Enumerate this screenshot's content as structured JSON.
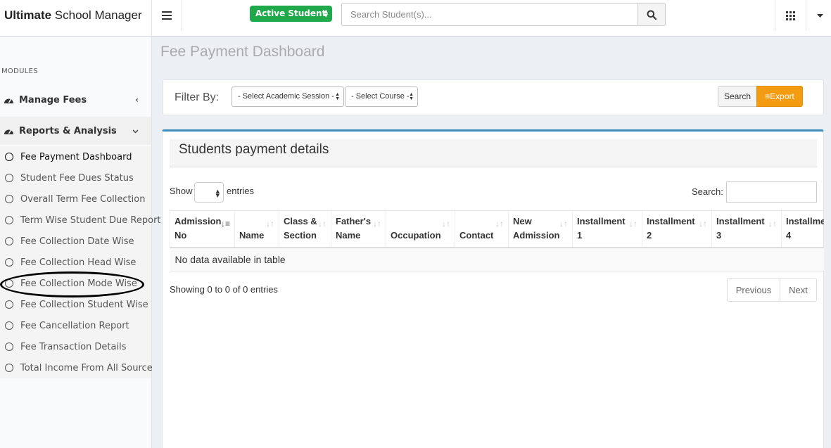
{
  "brand": {
    "bold": "Ultimate",
    "rest": " School Manager"
  },
  "topbar": {
    "active_student_label": "Active Student",
    "search_placeholder": "Search Student(s)..."
  },
  "sidebar": {
    "modules_label": "MODULES",
    "manage_fees": "Manage Fees",
    "reports_analysis": "Reports & Analysis",
    "items": [
      "Fee Payment Dashboard",
      "Student Fee Dues Status",
      "Overall Term Fee Collection",
      "Term Wise Student Due Report",
      "Fee Collection Date Wise",
      "Fee Collection Head Wise",
      "Fee Collection Mode Wise",
      "Fee Collection Student Wise",
      "Fee Cancellation Report",
      "Fee Transaction Details",
      "Total Income From All Source"
    ],
    "active_item": "Fee Payment Dashboard",
    "circled_item": "Fee Collection Mode Wise"
  },
  "page": {
    "title": "Fee Payment Dashboard",
    "filter_label": "Filter By:",
    "session_select": "- Select Academic Session -",
    "course_select": "- Select Course -",
    "search_button": "Search",
    "export_button": "Export"
  },
  "panel": {
    "title": "Students payment details",
    "show_label": "Show",
    "entries_label": "entries",
    "search_label": "Search:",
    "columns": [
      {
        "l1": "Admission",
        "l2": "No"
      },
      {
        "l1": "",
        "l2": "Name"
      },
      {
        "l1": "Class &",
        "l2": "Section"
      },
      {
        "l1": "Father's",
        "l2": "Name"
      },
      {
        "l1": "",
        "l2": "Occupation"
      },
      {
        "l1": "",
        "l2": "Contact"
      },
      {
        "l1": "New",
        "l2": "Admission"
      },
      {
        "l1": "Installment",
        "l2": "1"
      },
      {
        "l1": "Installment",
        "l2": "2"
      },
      {
        "l1": "Installment",
        "l2": "3"
      },
      {
        "l1": "Installment",
        "l2": "4"
      }
    ],
    "empty_message": "No data available in table",
    "info_text": "Showing 0 to 0 of 0 entries",
    "prev_label": "Previous",
    "next_label": "Next"
  },
  "colors": {
    "active_student_bg": "#1fa94a",
    "export_bg": "#f39c12",
    "panel_accent": "#3c8dbc"
  }
}
